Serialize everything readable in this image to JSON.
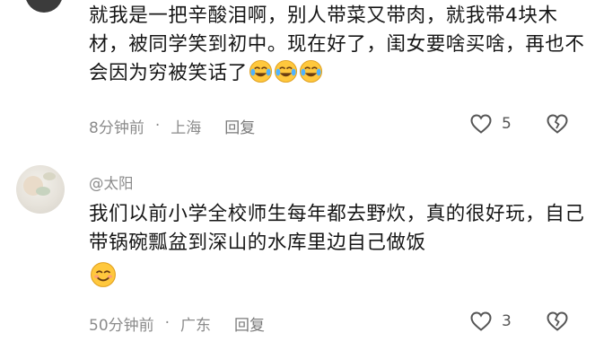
{
  "comments": [
    {
      "text": "就我是一把辛酸泪啊，别人带菜又带肉，就我带4块木材，被同学笑到初中。现在好了，闺女要啥买啥，再也不会因为穷被笑话了",
      "emoji": "crying-laughing-emoji",
      "time": "8分钟前",
      "location": "上海",
      "reply_label": "回复",
      "likes": "5"
    },
    {
      "username": "@太阳",
      "text": "我们以前小学全校师生每年都去野炊，真的很好玩，自己带锅碗瓢盆到深山的水库里边自己做饭",
      "emoji": "smiling-emoji",
      "time": "50分钟前",
      "location": "广东",
      "reply_label": "回复",
      "likes": "3"
    }
  ],
  "separator": "·",
  "colors": {
    "text": "#161616",
    "meta": "#8b8b8b",
    "emoji_yellow": "#ffc83d"
  }
}
